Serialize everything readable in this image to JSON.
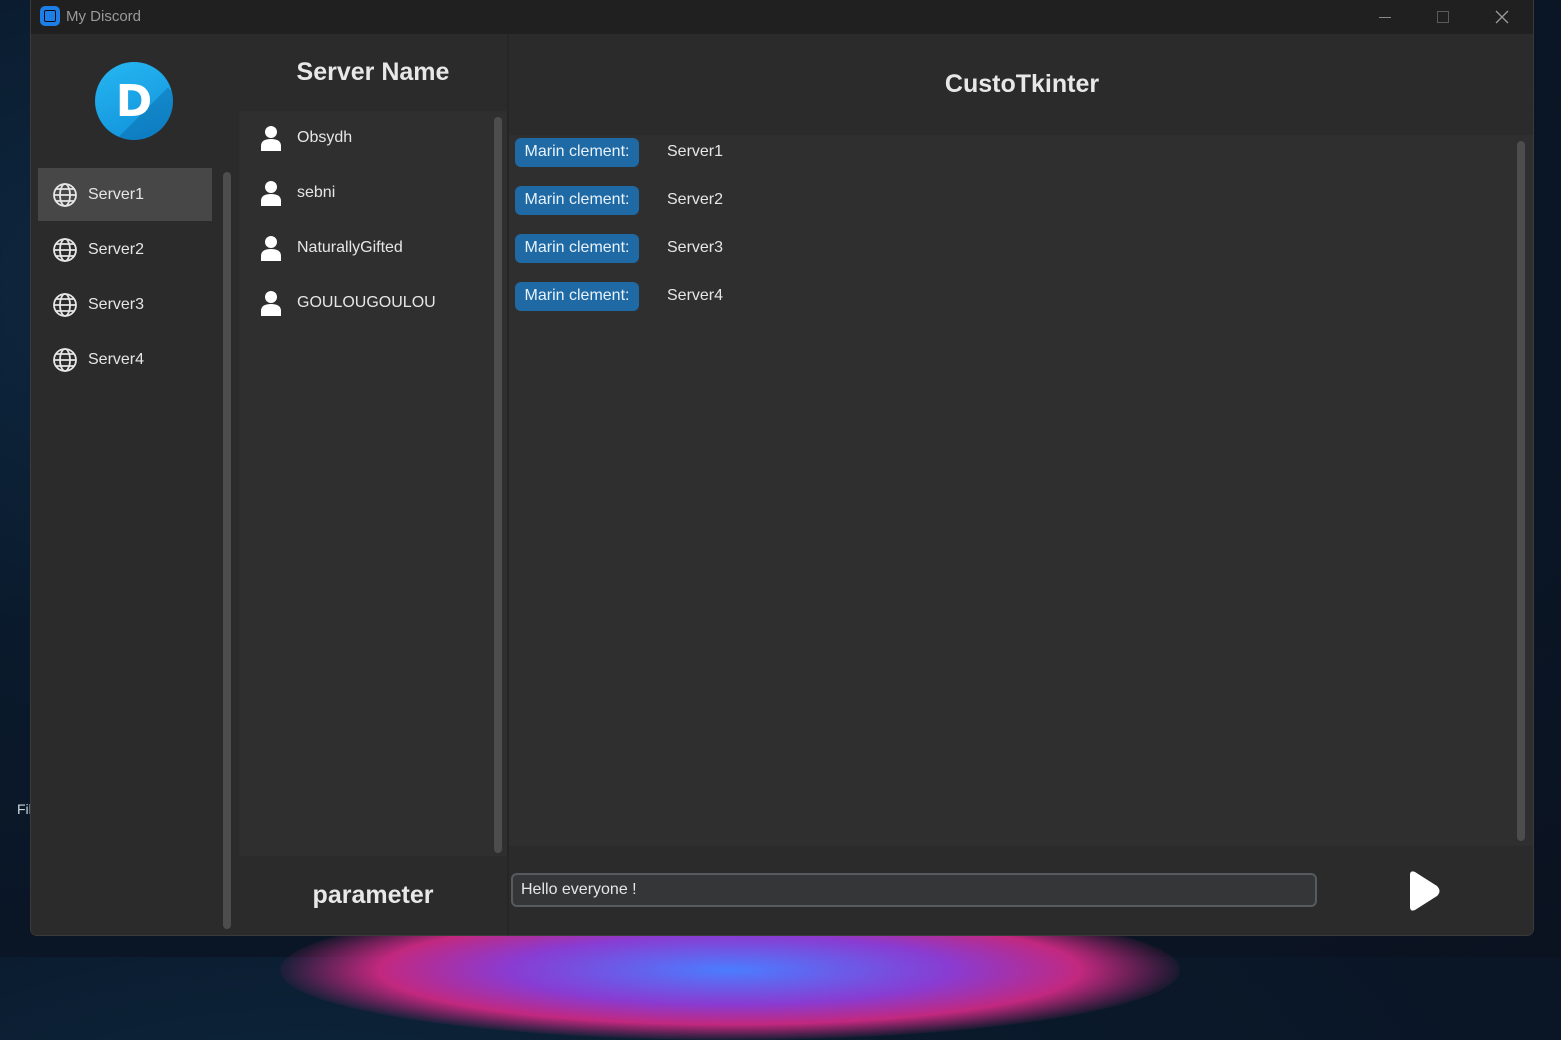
{
  "window": {
    "title": "My Discord",
    "app_icon": "app-icon"
  },
  "desktop": {
    "partial_text": "Fil"
  },
  "sidebar": {
    "logo_letter": "D",
    "logo_icon": "discord-d-logo",
    "server_icon": "globe-icon",
    "items": [
      {
        "label": "Server1",
        "active": true
      },
      {
        "label": "Server2",
        "active": false
      },
      {
        "label": "Server3",
        "active": false
      },
      {
        "label": "Server4",
        "active": false
      }
    ]
  },
  "members": {
    "title": "Server Name",
    "member_icon": "user-icon",
    "items": [
      {
        "label": "Obsydh"
      },
      {
        "label": "sebni"
      },
      {
        "label": "NaturallyGifted"
      },
      {
        "label": "GOULOUGOULOU"
      }
    ],
    "parameter_label": "parameter"
  },
  "chat": {
    "title": "CustoTkinter",
    "messages": [
      {
        "author": "Marin clement:",
        "text": "Server1"
      },
      {
        "author": "Marin clement:",
        "text": "Server2"
      },
      {
        "author": "Marin clement:",
        "text": "Server3"
      },
      {
        "author": "Marin clement:",
        "text": "Server4"
      }
    ],
    "input_value": "Hello everyone !",
    "send_icon": "send-play-icon"
  },
  "colors": {
    "accent": "#1f6aa5",
    "window_bg": "#242424",
    "panel_bg": "#2b2b2b",
    "list_bg": "#2f2f2f",
    "active_item": "#474747",
    "text": "#e6e6e6"
  }
}
